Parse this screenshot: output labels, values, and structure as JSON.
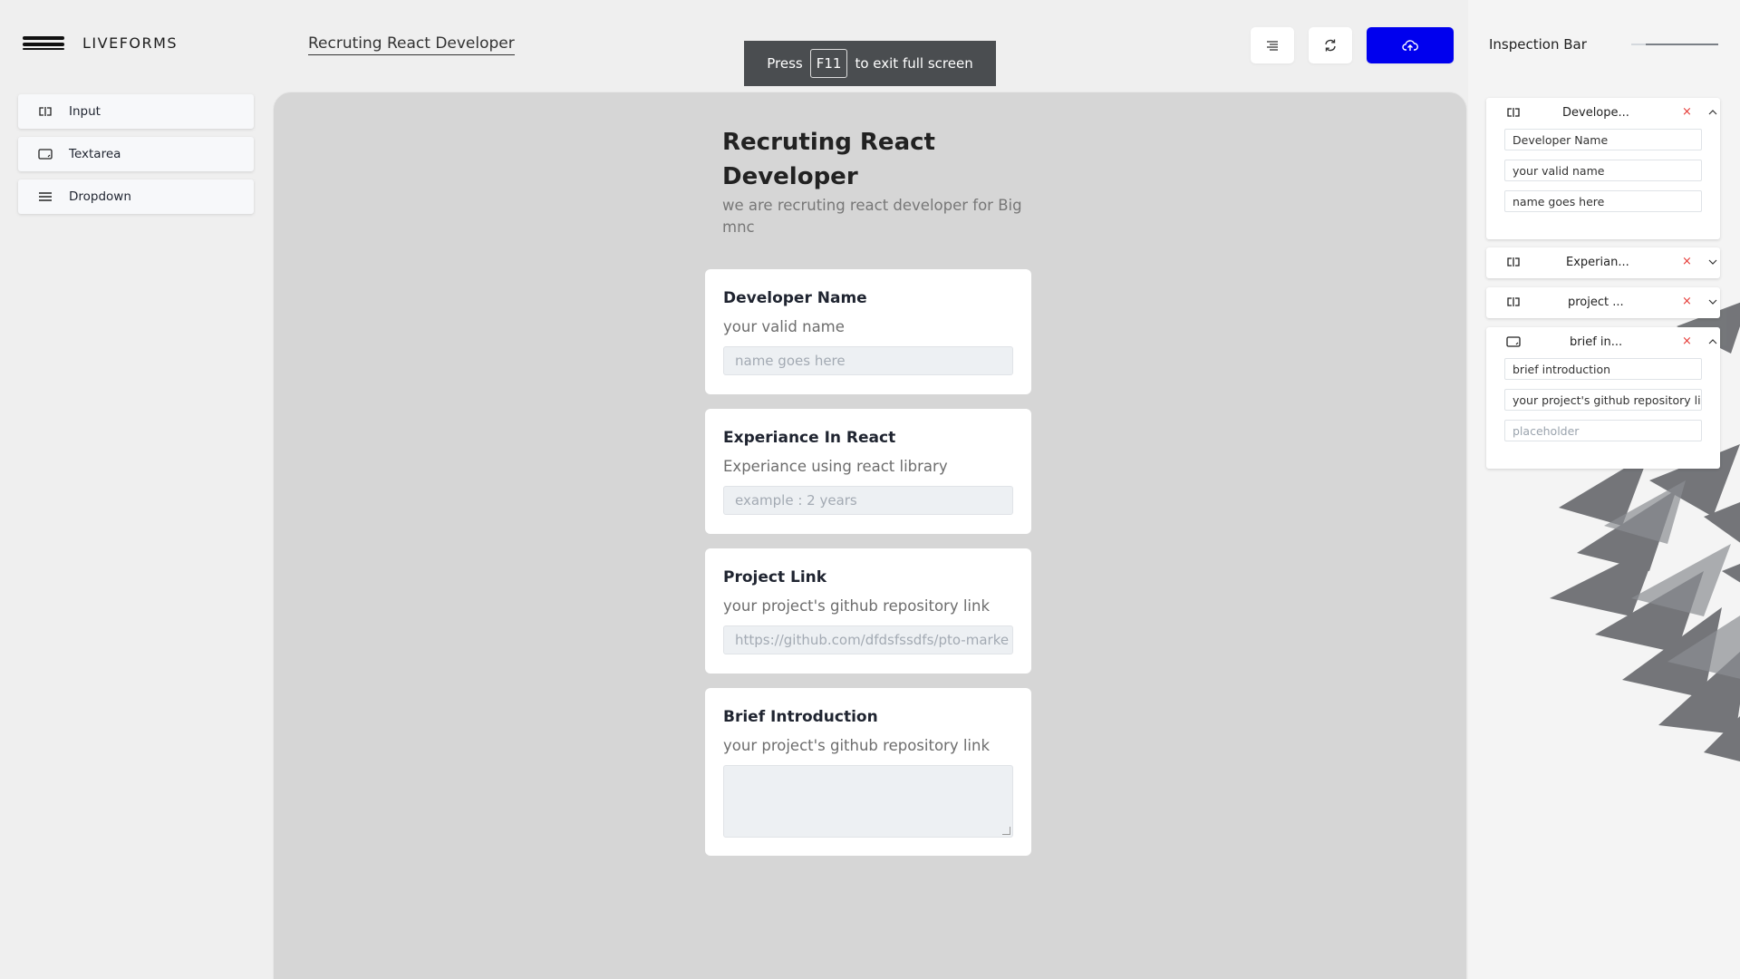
{
  "app": {
    "logo_text": "LIVEFORMS",
    "form_title": "Recruting React Developer"
  },
  "toast": {
    "press": "Press",
    "key": "F11",
    "rest": "to exit full screen"
  },
  "toolbar": {
    "list_icon": "list-icon",
    "refresh_icon": "refresh-icon",
    "upload_icon": "cloud-upload-icon",
    "upload_color": "#0000ee"
  },
  "sidebar": {
    "items": [
      {
        "label": "Input",
        "icon": "input-icon"
      },
      {
        "label": "Textarea",
        "icon": "textarea-icon"
      },
      {
        "label": "Dropdown",
        "icon": "dropdown-icon"
      }
    ]
  },
  "form": {
    "title": "Recruting React Developer",
    "description": "we are recruting react developer for Big mnc",
    "fields": [
      {
        "label": "Developer Name",
        "help": "your valid name",
        "placeholder": "name goes here",
        "type": "input"
      },
      {
        "label": "Experiance In React",
        "help": "Experiance using react library",
        "placeholder": "example : 2 years",
        "type": "input"
      },
      {
        "label": "Project Link",
        "help": "your project's github repository link",
        "placeholder": "https://github.com/dfdsfssdfs/pto-marke",
        "type": "input"
      },
      {
        "label": "Brief Introduction",
        "help": "your project's github repository link",
        "placeholder": "",
        "type": "textarea"
      }
    ]
  },
  "inspection": {
    "title": "Inspection Bar",
    "panels": [
      {
        "name": "Develope...",
        "expanded": true,
        "fields": [
          "Developer Name",
          "your valid name",
          "name goes here"
        ]
      },
      {
        "name": "Experian...",
        "expanded": false
      },
      {
        "name": "project ...",
        "expanded": false
      },
      {
        "name": "brief in...",
        "expanded": true,
        "fields": [
          "brief introduction",
          "your project's github repository lir",
          "placeholder"
        ]
      }
    ],
    "close_glyph": "×"
  }
}
